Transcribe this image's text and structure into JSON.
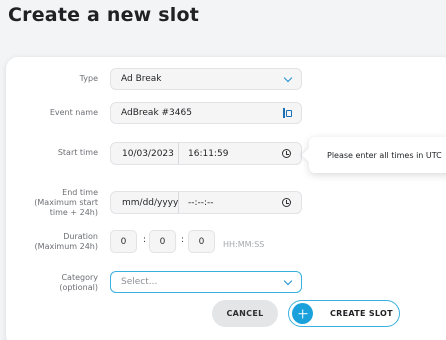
{
  "page": {
    "title": "Create a new slot"
  },
  "form": {
    "type": {
      "label": "Type",
      "value": "Ad Break"
    },
    "event_name": {
      "label": "Event name",
      "value": "AdBreak #3465"
    },
    "start_time": {
      "label": "Start time",
      "date": "10/03/2023",
      "time": "16:11:59"
    },
    "end_time": {
      "label_line1": "End time",
      "label_line2": "(Maximum start",
      "label_line3": "time + 24h)",
      "date_placeholder": "mm/dd/yyyy",
      "time_placeholder": "--:--:--"
    },
    "duration": {
      "label_line1": "Duration",
      "label_line2": "(Maximum 24h)",
      "hours": "0",
      "minutes": "0",
      "seconds": "0",
      "separator": ":",
      "format_hint": "HH:MM:SS"
    },
    "category": {
      "label_line1": "Category",
      "label_line2": "(optional)",
      "placeholder": "Select..."
    }
  },
  "tooltip": {
    "text": "Please enter all times in UTC"
  },
  "actions": {
    "cancel_label": "CANCEL",
    "create_label": "CREATE SLOT"
  },
  "colors": {
    "accent": "#1aa1dc",
    "border_focus": "#3ab0e0",
    "cancel_bg": "#e4e5e7"
  },
  "icons": [
    "chevron-down-icon",
    "card-icon",
    "clock-icon",
    "plus-icon"
  ]
}
